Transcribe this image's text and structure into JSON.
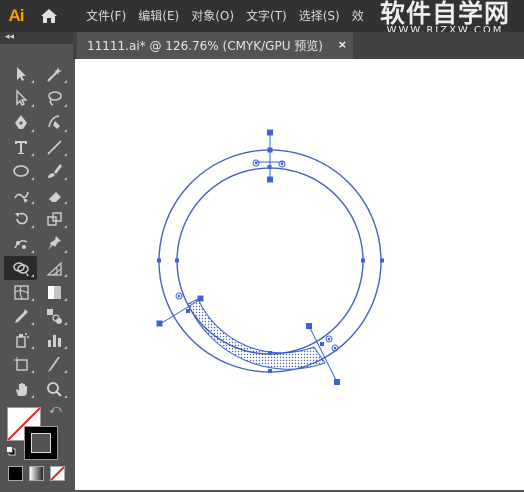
{
  "app": {
    "logo_text": "Ai",
    "home_icon": "home-icon"
  },
  "menu": {
    "items": [
      "文件(F)",
      "编辑(E)",
      "对象(O)",
      "文字(T)",
      "选择(S)",
      "效"
    ]
  },
  "watermark": {
    "title": "软件自学网",
    "url": "WWW.RJZXW.COM"
  },
  "toolbar": {
    "collapse_label": "◂◂",
    "tools": [
      "selection-tool",
      "magic-wand-tool",
      "direct-selection-tool",
      "lasso-tool",
      "pen-tool",
      "curvature-tool",
      "type-tool",
      "line-segment-tool",
      "ellipse-tool",
      "paintbrush-tool",
      "shaper-tool",
      "eraser-tool",
      "rotate-tool",
      "scale-tool",
      "puppet-warp-tool",
      "pin-tool",
      "shape-builder-tool",
      "perspective-grid-tool",
      "mesh-tool",
      "gradient-tool",
      "eyedropper-tool",
      "blend-tool",
      "symbol-sprayer-tool",
      "column-graph-tool",
      "artboard-tool",
      "slice-tool",
      "hand-tool",
      "zoom-tool"
    ],
    "active_tool": "shape-builder-tool"
  },
  "colors": {
    "fill": "#ffffff",
    "stroke": "#000000",
    "accent": "#3a64d8",
    "logo": "#ff9a00"
  },
  "document": {
    "tab_title": "11111.ai* @ 126.76% (CMYK/GPU 预览)",
    "close_label": "×"
  }
}
